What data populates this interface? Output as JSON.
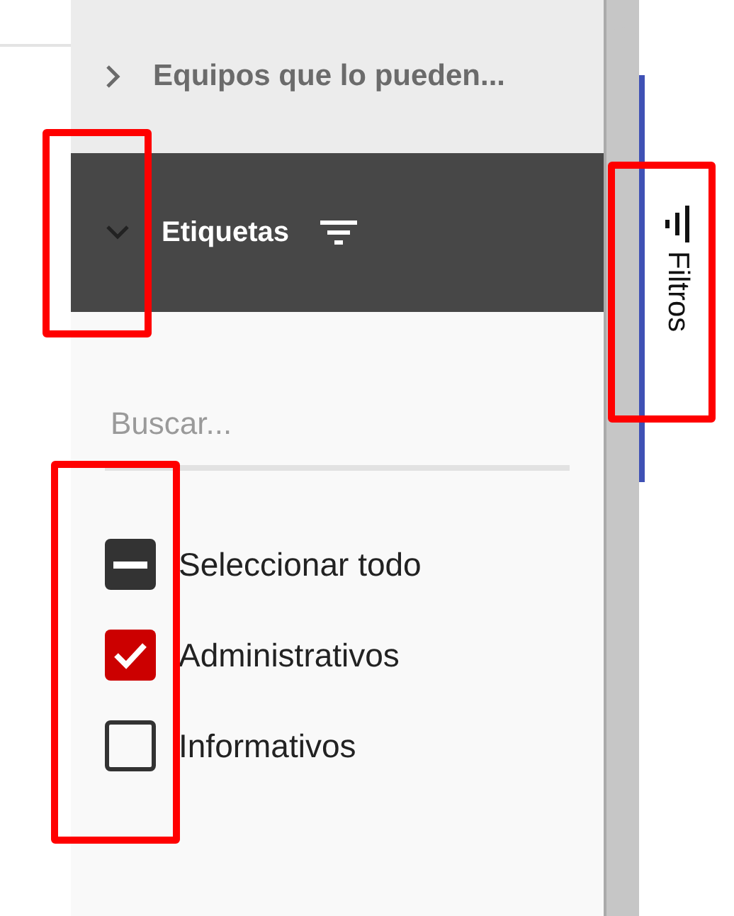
{
  "sections": [
    {
      "title": "Equipos que lo pueden...",
      "expanded": false,
      "filter_icon": false
    },
    {
      "title": "Etiquetas",
      "expanded": true,
      "filter_icon": true
    }
  ],
  "search": {
    "placeholder": "Buscar..."
  },
  "options": [
    {
      "label": "Seleccionar todo",
      "indeterminate": true
    },
    {
      "label": "Administrativos",
      "checked": true
    },
    {
      "label": "Informativos",
      "checked": false
    }
  ],
  "side_tab": {
    "label": "Filtros",
    "selected": true
  }
}
